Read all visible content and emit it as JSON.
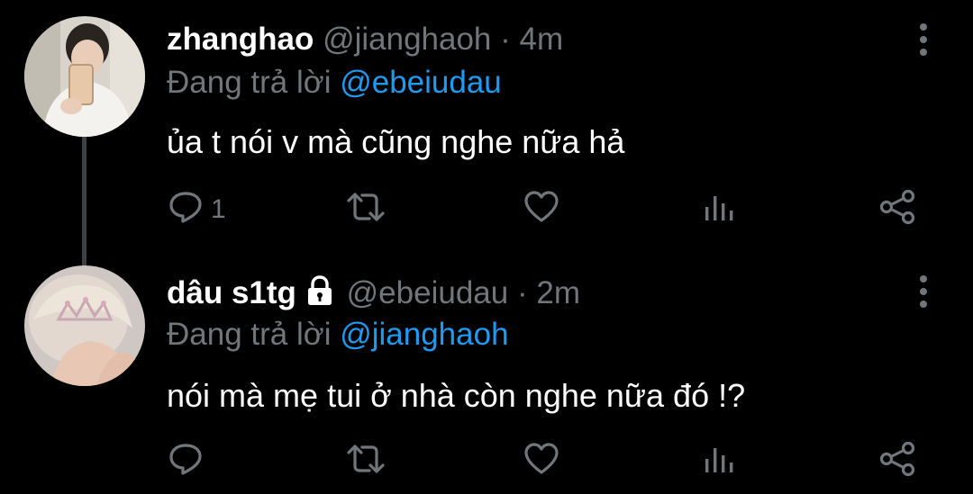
{
  "tweets": [
    {
      "display_name": "zhanghao",
      "handle": "@jianghaoh",
      "separator": "·",
      "time": "4m",
      "locked": false,
      "reply_prefix": "Đang trả lời",
      "reply_to": "@ebeiudau",
      "text": "ủa t nói v mà cũng nghe nữa hả",
      "reply_count": "1",
      "avatar_icon": "avatar-photo"
    },
    {
      "display_name": "dâu s1tg",
      "handle": "@ebeiudau",
      "separator": "·",
      "time": "2m",
      "locked": true,
      "reply_prefix": "Đang trả lời",
      "reply_to": "@jianghaoh",
      "text": "nói mà mẹ tui ở nhà còn nghe nữa đó !?",
      "reply_count": "",
      "avatar_icon": "avatar-photo"
    }
  ],
  "icons": {
    "reply": "reply-icon",
    "retweet": "retweet-icon",
    "like": "heart-icon",
    "views": "views-icon",
    "share": "share-icon",
    "more": "more-vertical-icon",
    "lock": "lock-icon"
  },
  "colors": {
    "background": "#000000",
    "primary_text": "#ffffff",
    "secondary_text": "#71767b",
    "link": "#1d9bf0",
    "thread_line": "#3e4144"
  }
}
